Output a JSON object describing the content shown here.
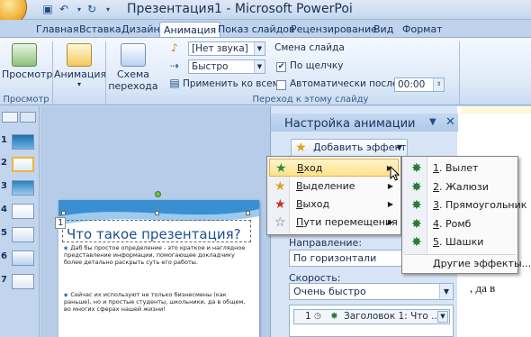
{
  "window": {
    "title": "Презентация1 - Microsoft PowerPoi"
  },
  "tabs": [
    "Главная",
    "Вставка",
    "Дизайн",
    "Анимация",
    "Показ слайдов",
    "Рецензирование",
    "Вид",
    "Формат"
  ],
  "ribbon": {
    "preview_label": "Просмотр",
    "preview_group": "Просмотр",
    "animation_label": "Анимация",
    "scheme_label_1": "Схема",
    "scheme_label_2": "перехода",
    "sound_value": "[Нет звука]",
    "speed_value": "Быстро",
    "apply_all_label": "Применить ко всем",
    "slide_change_label": "Смена слайда",
    "on_click_label": "По щелчку",
    "auto_after_label": "Автоматически после:",
    "auto_time": "00:00",
    "transition_group": "Переход к этому слайду"
  },
  "pane": {
    "title": "Настройка анимации",
    "add_effect": "Добавить эффект",
    "direction_label": "Направление:",
    "direction_value": "По горизонтали",
    "speed_label": "Скорость:",
    "speed_value": "Очень быстро",
    "list_item": "Заголовок 1: Что ...",
    "list_num": "1"
  },
  "effect_menu": [
    {
      "label": "Вход",
      "underline": "В",
      "rest": "ход"
    },
    {
      "label": "Выделение",
      "underline": "В",
      "rest": "ыделение"
    },
    {
      "label": "Выход",
      "underline": "В",
      "rest": "ыход"
    },
    {
      "label": "Пути перемещения",
      "underline": "П",
      "rest": "ути перемещения"
    }
  ],
  "entry_submenu": [
    {
      "num": "1",
      "label": "Вылет"
    },
    {
      "num": "2",
      "label": "Жалюзи"
    },
    {
      "num": "3",
      "label": "Прямоугольник"
    },
    {
      "num": "4",
      "label": "Ромб"
    },
    {
      "num": "5",
      "label": "Шашки"
    }
  ],
  "more_effects": "Другие эффекты...",
  "slide": {
    "title": "Что такое презентация?",
    "bullet1": "Даб бы простое определение - это краткое и наглядное представление информации, помогающее докладчику более детально раскрыть суть его работы.",
    "bullet2": "Сейчас их используют не только бизнесмены (как раньше), но и простые студенты, школьники, да в общем, во многих сферах нашей жизни!",
    "placeholder_num": "1"
  },
  "thumbnail_numbers": [
    "1",
    "2",
    "3",
    "4",
    "5",
    "6",
    "7"
  ],
  "doc_strip_text": ", да в",
  "colors": {
    "accent": "#f3b23c",
    "ribbon": "#dde9f8",
    "pane": "#d7e5f6",
    "highlight": "#fde28b"
  }
}
